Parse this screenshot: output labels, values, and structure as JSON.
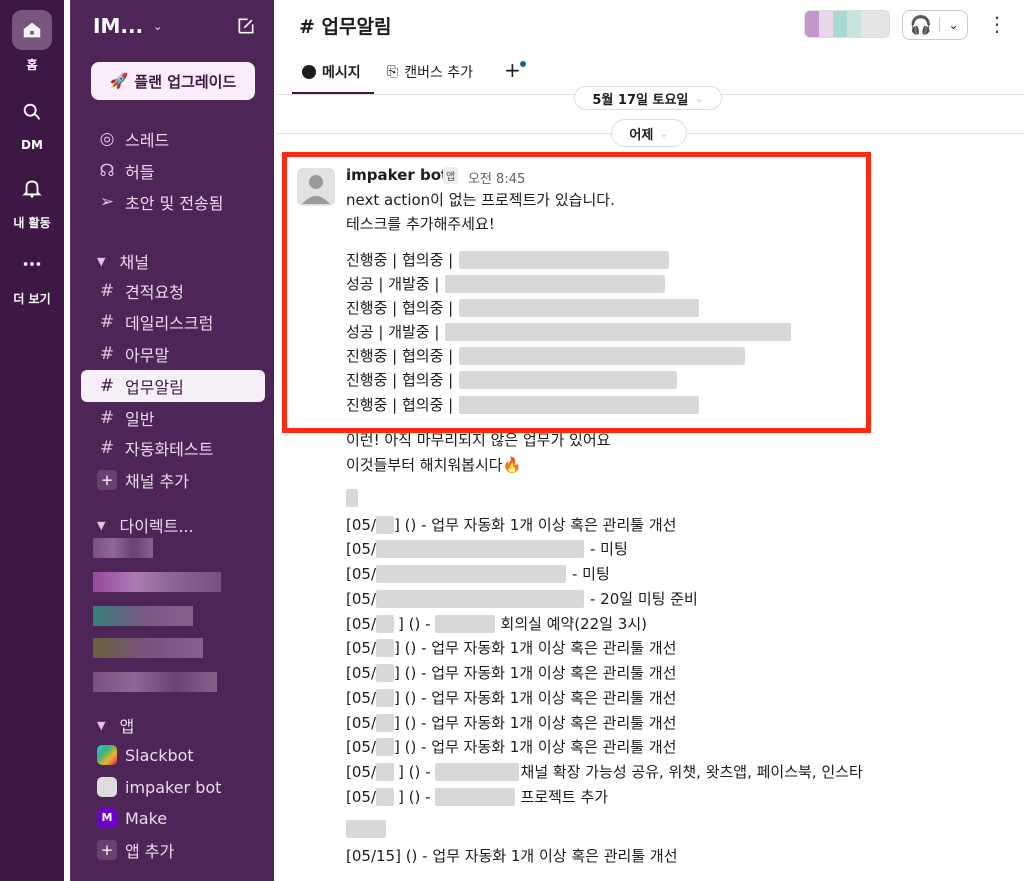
{
  "rail": {
    "home_label": "홈",
    "dm_label": "DM",
    "activity_label": "내 활동",
    "more_label": "더 보기"
  },
  "sidebar": {
    "workspace_name": "IM...",
    "upgrade_label": "플랜 업그레이드",
    "nav": [
      {
        "label": "스레드",
        "icon": "thread-icon"
      },
      {
        "label": "허들",
        "icon": "headphones-icon"
      },
      {
        "label": "초안 및 전송됨",
        "icon": "send-icon"
      }
    ],
    "channels_header": "채널",
    "channels": [
      "견적요청",
      "데일리스크럼",
      "아무말",
      "업무알림",
      "일반",
      "자동화테스트"
    ],
    "active_channel": "업무알림",
    "add_channel": "채널 추가",
    "dm_header": "다이렉트...",
    "apps_header": "앱",
    "apps": [
      "Slackbot",
      "impaker bot",
      "Make"
    ],
    "add_app": "앱 추가"
  },
  "header": {
    "channel_title": "# 업무알림",
    "tab_messages": "메시지",
    "tab_canvas": "캔버스 추가",
    "tab_add": "+"
  },
  "dividers": {
    "date_top": "5월 17일 토요일",
    "date_yesterday": "어제"
  },
  "message": {
    "author": "impaker bot",
    "badge": "앱",
    "time": "오전 8:45",
    "line1": "next action이 없는 프로젝트가 있습니다.",
    "line2": "테스크를 추가해주세요!",
    "status_lines": [
      "진행중 | 협의중 |",
      "성공 | 개발중 |",
      "진행중 | 협의중 |",
      "성공 | 개발중 |",
      "진행중 | 협의중 |",
      "진행중 | 협의중 |",
      "진행중 | 협의중 |"
    ],
    "reminder1": "이런! 아직 마무리되지 않은 업무가 있어요",
    "reminder2": "이것들부터 해치워봅시다🔥",
    "tasks": [
      {
        "prefix": "[05/",
        "text": "] () - 업무 자동화 1개 이상 혹은 관리툴 개선"
      },
      {
        "prefix": "[05/",
        "text": "- 미팅"
      },
      {
        "prefix": "[05/",
        "text": "- 미팅"
      },
      {
        "prefix": "[05/",
        "text": "- 20일 미팅 준비"
      },
      {
        "prefix": "[05/",
        "text": "회의실 예약(22일 3시)"
      },
      {
        "prefix": "[05/",
        "text": "] () - 업무 자동화 1개 이상 혹은 관리툴 개선"
      },
      {
        "prefix": "[05/",
        "text": "] () - 업무 자동화 1개 이상 혹은 관리툴 개선"
      },
      {
        "prefix": "[05/",
        "text": "] () - 업무 자동화 1개 이상 혹은 관리툴 개선"
      },
      {
        "prefix": "[05/",
        "text": "] () - 업무 자동화 1개 이상 혹은 관리툴 개선"
      },
      {
        "prefix": "[05/",
        "text": "] () - 업무 자동화 1개 이상 혹은 관리툴 개선"
      },
      {
        "prefix": "[05/",
        "text": "채널 확장 가능성 공유, 위챗, 왓츠앱, 페이스북, 인스타"
      },
      {
        "prefix": "[05/",
        "text": "프로젝트 추가"
      }
    ],
    "last_task": "[05/15] () - 업무 자동화 1개 이상 혹은 관리툴 개선"
  },
  "colors": {
    "rail_bg": "#3d1844",
    "sidebar_bg": "#4e2557",
    "highlight_border": "#ff2a12"
  }
}
